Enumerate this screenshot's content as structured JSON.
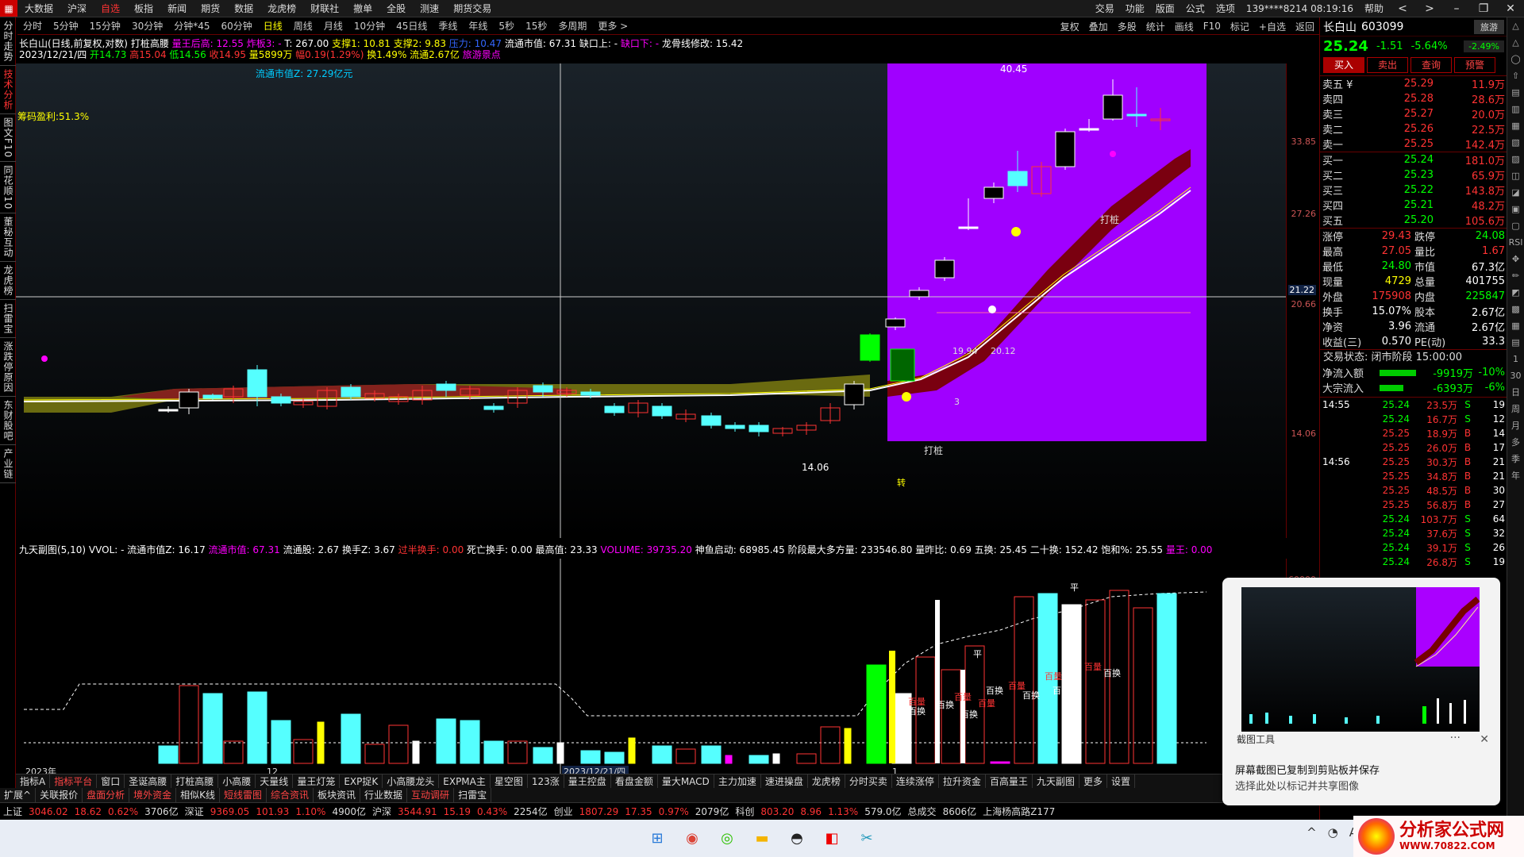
{
  "menubar": {
    "logo": "▦",
    "items": [
      "大数据",
      "沪深",
      "自选",
      "板指",
      "新闻",
      "期货",
      "数据",
      "龙虎榜",
      "财联社",
      "撤单",
      "全股",
      "测速",
      "期货交易"
    ],
    "active": 2,
    "right": [
      "交易",
      "功能",
      "版面",
      "公式",
      "选项",
      "139****8214 08:19:16",
      "帮助"
    ],
    "controls": [
      "<",
      ">",
      "–",
      "❐",
      "✕"
    ]
  },
  "periodbar": {
    "items": [
      "分时",
      "5分钟",
      "15分钟",
      "30分钟",
      "分钟*45",
      "60分钟",
      "日线",
      "周线",
      "月线",
      "10分钟",
      "45日线",
      "季线",
      "年线",
      "5秒",
      "15秒",
      "多周期",
      "更多 >"
    ],
    "active": 6,
    "right": [
      "复权",
      "叠加",
      "多股",
      "统计",
      "画线",
      "F10",
      "标记",
      "+自选",
      "返回"
    ]
  },
  "lefttabs": [
    "分时走势",
    "技术分析",
    "图文F10",
    "同花顺10",
    "董秘互动",
    "龙虎榜",
    "扫雷宝",
    "涨跌停原因",
    "东财股吧",
    "产业链"
  ],
  "lefttab_active": 1,
  "info": {
    "line1_stock": "长白山(日线,前复权,对数)",
    "line1_ind": "打桩高腰",
    "line1_a": "量王后高: 12.55",
    "line1_b": "炸板3: -",
    "line1_c": "T: 267.00",
    "line1_d": "支撑1: 10.81",
    "line1_e": "支撑2: 9.83",
    "line1_f": "压力: 10.47",
    "line1_g": "流通市值: 67.31",
    "line1_h": "缺口上: -",
    "line1_i": "缺口下: -",
    "line1_j": "龙骨线修改: 15.42",
    "line2_a": "2023/12/21/四",
    "line2_b": "开14.73",
    "line2_c": "高15.04",
    "line2_d": "低14.56",
    "line2_e": "收14.95",
    "line2_f": "量5899万",
    "line2_g": "幅0.19(1.29%)",
    "line2_h": "换1.49%",
    "line2_i": "流通2.67亿",
    "line2_j": "旅游景点",
    "mv_label": "流通市值Z: 27.29亿元",
    "chip": "筹码盈利:51.3%"
  },
  "price_ticks": [
    "33.85",
    "27.26",
    "21.22",
    "20.66",
    "14.06"
  ],
  "annotations": {
    "high": "40.45",
    "low": "14.06",
    "mid": "19.94",
    "mid2": "20.12",
    "dz1": "打桩",
    "dz2": "打桩",
    "num3": "3",
    "zhuan": "转"
  },
  "sub": {
    "title": "九天副图(5,10)",
    "a": "VVOL: -",
    "b": "流通市值Z: 16.17",
    "c": "流通市值: 67.31",
    "d": "流通股: 2.67",
    "e": "换手Z: 3.67",
    "f": "过半换手: 0.00",
    "g": "死亡换手: 0.00",
    "h": "最高值: 23.33",
    "i": "VOLUME: 39735.20",
    "j": "神鱼启动: 68985.45",
    "k": "阶段最大多方量: 233546.80",
    "l": "量昨比: 0.69",
    "m": "五换: 25.45",
    "n": "二十换: 152.42",
    "o": "饱和%: 25.55",
    "p": "量王: 0.00",
    "vol_tick": "60000",
    "labels": [
      "百换",
      "百换",
      "百换",
      "百换",
      "百换",
      "百换",
      "百换"
    ],
    "labels_red": [
      "百量",
      "百量",
      "百量",
      "百量",
      "百量",
      "百量"
    ],
    "flat": "平"
  },
  "dates": [
    "2023年",
    "12",
    "2023/12/21/四",
    "1"
  ],
  "toolbar1": [
    "指标A",
    "指标平台",
    "窗口",
    "圣诞高腰",
    "打桩高腰",
    "小高腰",
    "天量线",
    "量王灯笼",
    "EXP捉K",
    "小高腰龙头",
    "EXPMA主",
    "星空图",
    "123涨",
    "量王控盘",
    "看盘金额",
    "量大MACD",
    "主力加速",
    "速进操盘",
    "龙虎榜",
    "分时买卖",
    "连续涨停",
    "拉升资金",
    "百高量王",
    "九天副图",
    "更多",
    "设置"
  ],
  "toolbar1_red": [
    1
  ],
  "toolbar2": [
    "扩展^",
    "关联报价",
    "盘面分析",
    "境外资金",
    "相似K线",
    "短线雷图",
    "综合资讯",
    "板块资讯",
    "行业数据",
    "互动调研",
    "扫雷宝"
  ],
  "toolbar2_red": [
    2,
    3,
    5,
    6,
    9
  ],
  "indexbar": [
    {
      "t": "上证",
      "c": "#ddd"
    },
    {
      "t": "3046.02",
      "c": "#f33"
    },
    {
      "t": "18.62",
      "c": "#f33"
    },
    {
      "t": "0.62%",
      "c": "#f33"
    },
    {
      "t": "3706亿",
      "c": "#ddd"
    },
    {
      "t": "深证",
      "c": "#ddd"
    },
    {
      "t": "9369.05",
      "c": "#f33"
    },
    {
      "t": "101.93",
      "c": "#f33"
    },
    {
      "t": "1.10%",
      "c": "#f33"
    },
    {
      "t": "4900亿",
      "c": "#ddd"
    },
    {
      "t": "沪深",
      "c": "#ddd"
    },
    {
      "t": "3544.91",
      "c": "#f33"
    },
    {
      "t": "15.19",
      "c": "#f33"
    },
    {
      "t": "0.43%",
      "c": "#f33"
    },
    {
      "t": "2254亿",
      "c": "#ddd"
    },
    {
      "t": "创业",
      "c": "#ddd"
    },
    {
      "t": "1807.29",
      "c": "#f33"
    },
    {
      "t": "17.35",
      "c": "#f33"
    },
    {
      "t": "0.97%",
      "c": "#f33"
    },
    {
      "t": "2079亿",
      "c": "#ddd"
    },
    {
      "t": "科创",
      "c": "#ddd"
    },
    {
      "t": "803.20",
      "c": "#f33"
    },
    {
      "t": "8.96",
      "c": "#f33"
    },
    {
      "t": "1.13%",
      "c": "#f33"
    },
    {
      "t": "579.0亿",
      "c": "#ddd"
    },
    {
      "t": "总成交",
      "c": "#ddd"
    },
    {
      "t": "8606亿",
      "c": "#ddd"
    },
    {
      "t": "上海杨高路Z177",
      "c": "#ddd"
    }
  ],
  "quote": {
    "name": "长白山",
    "code": "603099",
    "tag": "旅游",
    "price": "25.24",
    "chg": "-1.51",
    "pct": "-5.64%",
    "tag_pct": "-2.49%",
    "buttons": [
      "买入",
      "卖出",
      "查询",
      "预警"
    ],
    "asks": [
      [
        "卖五 ¥",
        "25.29",
        "11.9万"
      ],
      [
        "卖四",
        "25.28",
        "28.6万"
      ],
      [
        "卖三",
        "25.27",
        "20.0万"
      ],
      [
        "卖二",
        "25.26",
        "22.5万"
      ],
      [
        "卖一",
        "25.25",
        "142.4万"
      ]
    ],
    "bids": [
      [
        "买一",
        "25.24",
        "181.0万"
      ],
      [
        "买二",
        "25.23",
        "65.9万"
      ],
      [
        "买三",
        "25.22",
        "143.8万"
      ],
      [
        "买四",
        "25.21",
        "48.2万"
      ],
      [
        "买五",
        "25.20",
        "105.6万"
      ]
    ],
    "stats": [
      [
        "涨停",
        "29.43",
        "跌停",
        "24.08"
      ],
      [
        "最高",
        "27.05",
        "量比",
        "1.67"
      ],
      [
        "最低",
        "24.80",
        "市值",
        "67.3亿"
      ],
      [
        "现量",
        "4729",
        "总量",
        "401755"
      ],
      [
        "外盘",
        "175908",
        "内盘",
        "225847"
      ],
      [
        "换手",
        "15.07%",
        "股本",
        "2.67亿"
      ],
      [
        "净资",
        "3.96",
        "流通",
        "2.67亿"
      ],
      [
        "收益(三)",
        "0.570",
        "PE(动)",
        "33.3"
      ]
    ],
    "status": "交易状态: 闭市阶段 15:00:00",
    "flow1_label": "净流入额",
    "flow1_val": "-9919万",
    "flow1_pct": "-10%",
    "flow2_label": "大宗流入",
    "flow2_val": "-6393万",
    "flow2_pct": "-6%",
    "ticks": [
      [
        "14:55",
        "25.24",
        "23.5万",
        "S",
        "19"
      ],
      [
        "",
        "25.24",
        "16.7万",
        "S",
        "12"
      ],
      [
        "",
        "25.25",
        "18.9万",
        "B",
        "14"
      ],
      [
        "",
        "25.25",
        "26.0万",
        "B",
        "17"
      ],
      [
        "14:56",
        "25.25",
        "30.3万",
        "B",
        "21"
      ],
      [
        "",
        "25.25",
        "34.8万",
        "B",
        "21"
      ],
      [
        "",
        "25.25",
        "48.5万",
        "B",
        "30"
      ],
      [
        "",
        "25.25",
        "56.8万",
        "B",
        "27"
      ],
      [
        "",
        "25.24",
        "103.7万",
        "S",
        "64"
      ],
      [
        "",
        "25.24",
        "37.6万",
        "S",
        "32"
      ],
      [
        "",
        "25.24",
        "39.1万",
        "S",
        "26"
      ],
      [
        "",
        "25.24",
        "26.8万",
        "S",
        "19"
      ]
    ]
  },
  "sidetools": [
    "△",
    "△",
    "◯",
    "⇧",
    "▤",
    "▥",
    "▦",
    "▧",
    "▨",
    "◫",
    "◪",
    "▣",
    "▢",
    "RSI",
    "✥",
    "✏",
    "◩",
    "▩",
    "▦",
    "▤",
    "1",
    "30",
    "日",
    "周",
    "月",
    "多",
    "季",
    "年"
  ],
  "popup": {
    "title": "截图工具",
    "dots": "···",
    "close": "✕",
    "msg1": "屏幕截图已复制到剪贴板并保存",
    "msg2": "选择此处以标记并共享图像"
  },
  "taskbar": [
    "⊞",
    "◉",
    "◎",
    "▬",
    "◓",
    "◧",
    "✂"
  ],
  "tray": [
    "^",
    "◔",
    "A"
  ],
  "brand": {
    "b1": "分析家公式网",
    "b2": "WWW.70822.COM"
  }
}
